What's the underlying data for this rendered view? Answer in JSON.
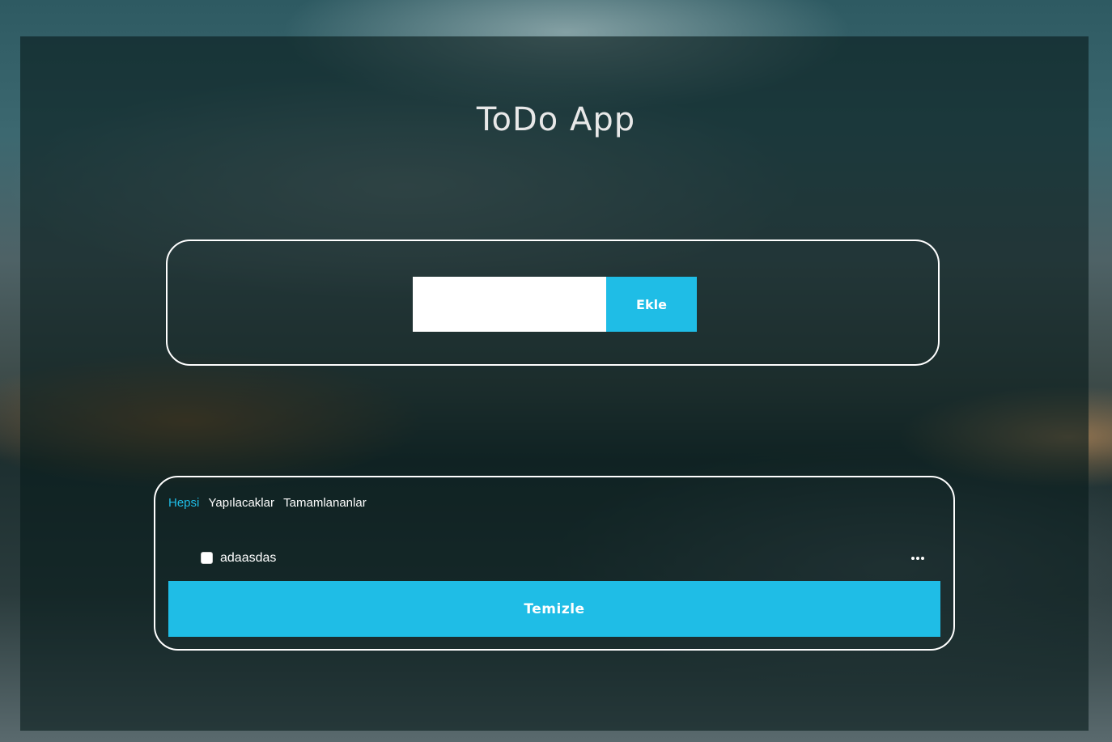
{
  "app": {
    "title": "ToDo App"
  },
  "add_form": {
    "input_value": "",
    "input_placeholder": "",
    "add_label": "Ekle"
  },
  "filters": {
    "all": "Hepsi",
    "todo": "Yapılacaklar",
    "completed": "Tamamlananlar",
    "active": "all"
  },
  "todos": [
    {
      "text": "adaasdas",
      "completed": false
    }
  ],
  "clear_label": "Temizle",
  "colors": {
    "accent": "#1fbde6",
    "panel_border": "#ffffff",
    "overlay": "#081c1c"
  }
}
